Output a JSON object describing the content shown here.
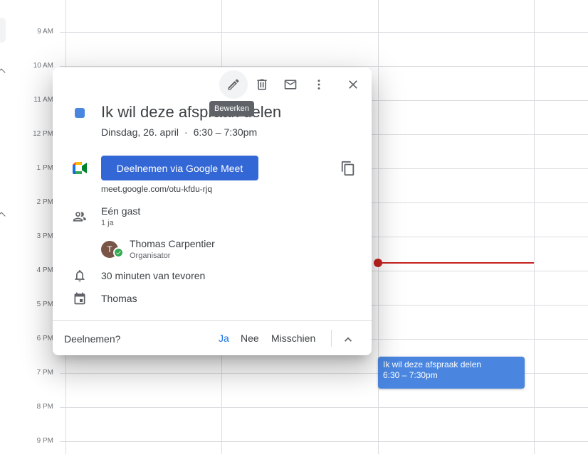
{
  "calendar": {
    "hours": [
      "9 AM",
      "10 AM",
      "11 AM",
      "12 PM",
      "1 PM",
      "2 PM",
      "3 PM",
      "4 PM",
      "5 PM",
      "6 PM",
      "7 PM",
      "8 PM",
      "9 PM"
    ],
    "event_block": {
      "title": "Ik wil deze afspraak delen",
      "time": "6:30 – 7:30pm",
      "color": "#4a86e0"
    },
    "now_indicator_color": "#c5221f"
  },
  "popup": {
    "toolbar": {
      "edit_icon": "pencil-icon",
      "delete_icon": "trash-icon",
      "email_icon": "mail-icon",
      "more_icon": "more-vert-icon",
      "close_icon": "close-icon",
      "tooltip": "Bewerken"
    },
    "event": {
      "color": "#4a86e0",
      "title": "Ik wil deze afspraak delen",
      "date": "Dinsdag, 26. april",
      "separator": "·",
      "time": "6:30 – 7:30pm"
    },
    "meet": {
      "button_label": "Deelnemen via Google Meet",
      "link": "meet.google.com/otu-kfdu-rjq",
      "button_color": "#3367d6"
    },
    "guests": {
      "title": "Eén gast",
      "summary": "1 ja",
      "organizer": {
        "initial": "T",
        "name": "Thomas Carpentier",
        "role": "Organisator"
      }
    },
    "reminder": "30 minuten van tevoren",
    "calendar_name": "Thomas",
    "rsvp": {
      "question": "Deelnemen?",
      "yes": "Ja",
      "no": "Nee",
      "maybe": "Misschien",
      "selected": "yes",
      "accent": "#1a73e8"
    }
  }
}
